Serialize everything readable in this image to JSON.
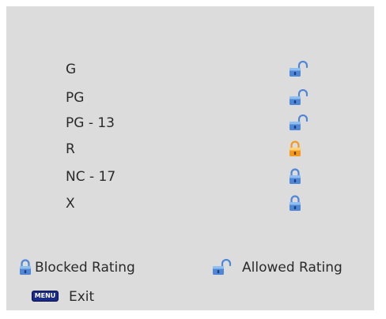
{
  "parental_lock": {
    "ratings": [
      {
        "label": "G",
        "state": "allowed",
        "lock_icon": "unlocked-padlock-icon",
        "lock_color": "#4f86d6"
      },
      {
        "label": "PG",
        "state": "allowed",
        "lock_icon": "unlocked-padlock-icon",
        "lock_color": "#4f86d6"
      },
      {
        "label": "PG - 13",
        "state": "allowed",
        "lock_icon": "unlocked-padlock-icon",
        "lock_color": "#4f86d6"
      },
      {
        "label": "R",
        "state": "blocked",
        "lock_icon": "locked-padlock-icon",
        "lock_color": "#f39a1e"
      },
      {
        "label": "NC - 17",
        "state": "blocked",
        "lock_icon": "locked-padlock-icon",
        "lock_color": "#4f86d6"
      },
      {
        "label": "X",
        "state": "blocked",
        "lock_icon": "locked-padlock-icon",
        "lock_color": "#4f86d6"
      }
    ]
  },
  "legend": {
    "blocked_label": "Blocked Rating",
    "blocked_icon": "locked-padlock-icon",
    "allowed_label": "Allowed Rating",
    "allowed_icon": "unlocked-padlock-icon"
  },
  "footer": {
    "menu_key_label": "MENU",
    "exit_label": "Exit"
  },
  "colors": {
    "panel_background": "#dcdcdc",
    "text": "#2a2a2a",
    "lock_blue": "#4f86d6",
    "lock_orange": "#f39a1e",
    "menu_key": "#1a2a8a"
  }
}
